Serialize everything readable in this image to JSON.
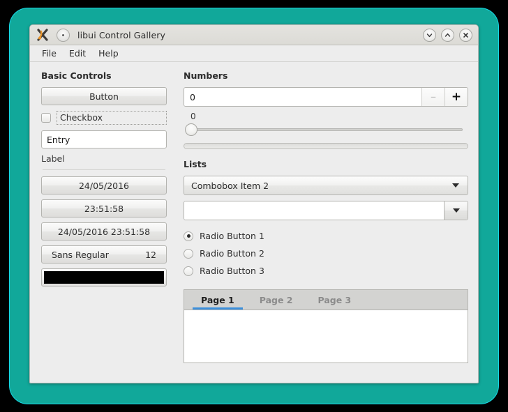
{
  "window": {
    "title": "libui Control Gallery",
    "app_icon": "app-x-icon",
    "wm_menu_icon": "window-menu-dot-icon",
    "buttons": [
      {
        "name": "minimize-button",
        "icon": "chevron-down-icon"
      },
      {
        "name": "maximize-button",
        "icon": "chevron-up-icon"
      },
      {
        "name": "close-button",
        "icon": "close-x-icon"
      }
    ]
  },
  "menubar": {
    "items": [
      {
        "label": "File"
      },
      {
        "label": "Edit"
      },
      {
        "label": "Help"
      }
    ]
  },
  "basic_controls": {
    "title": "Basic Controls",
    "button_label": "Button",
    "checkbox": {
      "label": "Checkbox",
      "checked": false
    },
    "entry": {
      "value": "Entry",
      "placeholder": ""
    },
    "label": "Label",
    "date_button": "24/05/2016",
    "time_button": "23:51:58",
    "datetime_button": "24/05/2016 23:51:58",
    "font_button": {
      "family": "Sans Regular",
      "size": "12"
    },
    "color_button": {
      "color": "#000000"
    }
  },
  "numbers": {
    "title": "Numbers",
    "spinbox": {
      "value": "0",
      "minus_label": "–",
      "plus_label": "+"
    },
    "slider": {
      "value_label": "0",
      "value": 0,
      "min": 0,
      "max": 100
    },
    "progress": {
      "value": 0,
      "min": 0,
      "max": 100
    }
  },
  "lists": {
    "title": "Lists",
    "combobox": {
      "selected": "Combobox Item 2"
    },
    "editable_combobox": {
      "value": "",
      "placeholder": ""
    },
    "radios": [
      {
        "label": "Radio Button 1",
        "selected": true
      },
      {
        "label": "Radio Button 2",
        "selected": false
      },
      {
        "label": "Radio Button 3",
        "selected": false
      }
    ]
  },
  "tabs": {
    "items": [
      {
        "label": "Page 1",
        "active": true
      },
      {
        "label": "Page 2",
        "active": false
      },
      {
        "label": "Page 3",
        "active": false
      }
    ]
  },
  "colors": {
    "desktop_background": "#000000",
    "frame_teal": "#11a89a",
    "frame_outline": "#16d9e6",
    "window_background": "#ededed",
    "titlebar": "#dfdedb",
    "tab_active_underline": "#3c8fdb",
    "tabstrip": "#d3d3d1"
  }
}
